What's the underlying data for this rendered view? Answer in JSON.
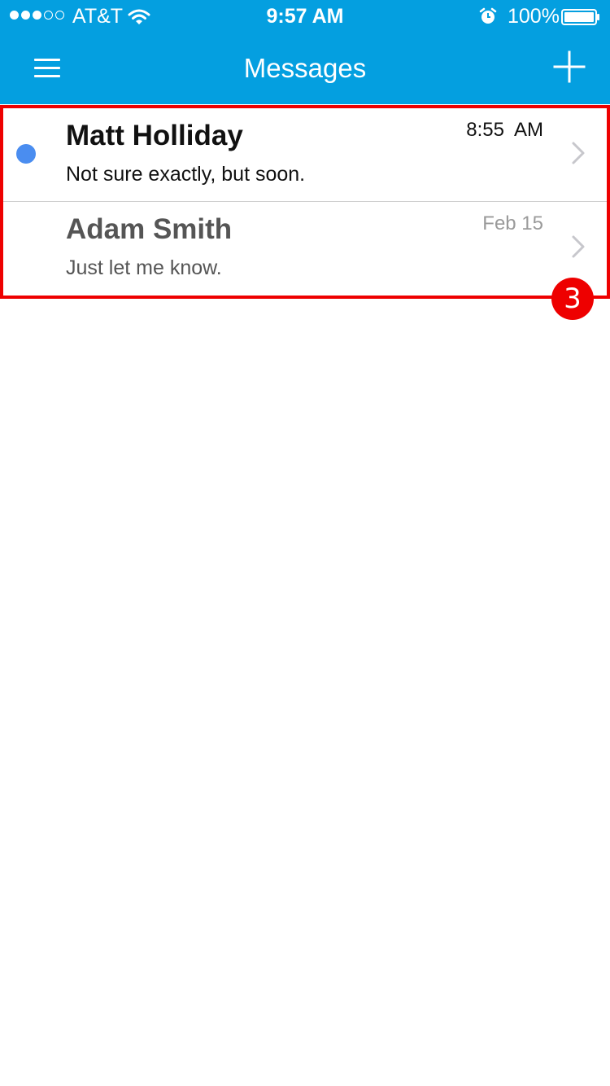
{
  "status_bar": {
    "carrier": "AT&T",
    "time": "9:57 AM",
    "battery": "100%",
    "signal_strength_bars": 3,
    "signal_total_bars": 5,
    "icons": [
      "wifi-icon",
      "alarm-icon",
      "battery-icon"
    ]
  },
  "header": {
    "title": "Messages",
    "menu_icon": "hamburger-menu-icon",
    "add_icon": "plus-icon"
  },
  "messages": [
    {
      "name": "Matt Holliday",
      "time": "8:55  AM",
      "preview": "Not sure exactly, but soon.",
      "unread": true
    },
    {
      "name": "Adam Smith",
      "time": "Feb 15",
      "preview": "Just let me know.",
      "unread": false
    }
  ],
  "annotation": {
    "badge": "3"
  },
  "colors": {
    "header_bg": "#049fe0",
    "unread_dot": "#4a8df0",
    "highlight": "#ee0000"
  }
}
